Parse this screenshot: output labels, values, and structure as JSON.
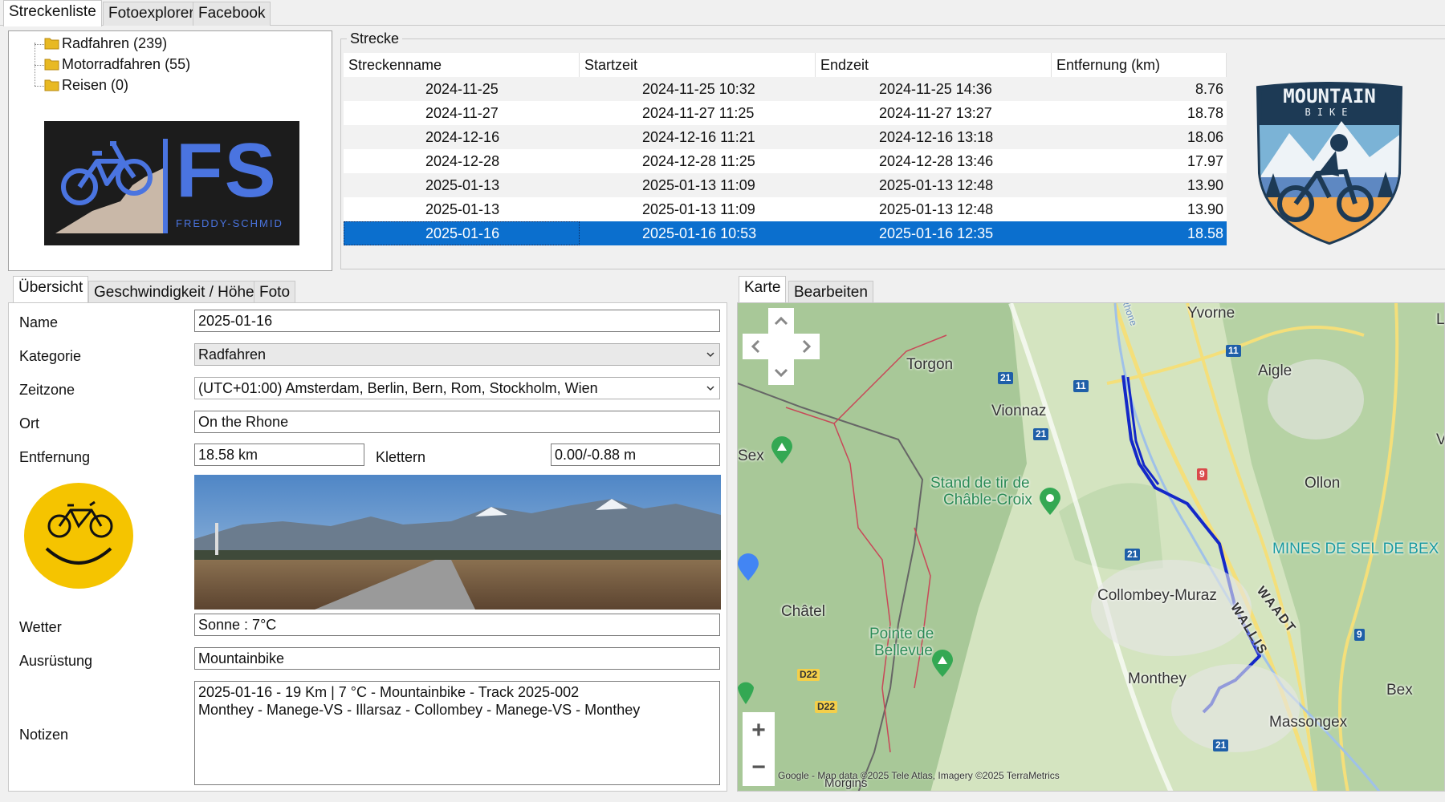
{
  "top_tabs": [
    "Streckenliste",
    "Fotoexplorer",
    "Facebook"
  ],
  "tree": [
    {
      "label": "Radfahren (239)"
    },
    {
      "label": "Motorradfahren (55)"
    },
    {
      "label": "Reisen (0)"
    }
  ],
  "logo_fs": {
    "letters": "FS",
    "subtitle": "FREDDY-SCHMID"
  },
  "strecke": {
    "group_label": "Strecke",
    "columns": [
      "Streckenname",
      "Startzeit",
      "Endzeit",
      "Entfernung (km)"
    ],
    "rows": [
      [
        "2024-11-25",
        "2024-11-25 10:32",
        "2024-11-25 14:36",
        "8.76"
      ],
      [
        "2024-11-27",
        "2024-11-27 11:25",
        "2024-11-27 13:27",
        "18.78"
      ],
      [
        "2024-12-16",
        "2024-12-16 11:21",
        "2024-12-16 13:18",
        "18.06"
      ],
      [
        "2024-12-28",
        "2024-12-28 11:25",
        "2024-12-28 13:46",
        "17.97"
      ],
      [
        "2025-01-13",
        "2025-01-13 11:09",
        "2025-01-13 12:48",
        "13.90"
      ],
      [
        "2025-01-13",
        "2025-01-13 11:09",
        "2025-01-13 12:48",
        "13.90"
      ],
      [
        "2025-01-16",
        "2025-01-16 10:53",
        "2025-01-16 12:35",
        "18.58"
      ]
    ],
    "selected_index": 6
  },
  "badge": {
    "line1": "MOUNTAIN",
    "line2": "BIKE"
  },
  "detail_tabs": [
    "Übersicht",
    "Geschwindigkeit / Höhe",
    "Foto"
  ],
  "form": {
    "name_label": "Name",
    "name_value": "2025-01-16",
    "kategorie_label": "Kategorie",
    "kategorie_value": "Radfahren",
    "zeitzone_label": "Zeitzone",
    "zeitzone_value": "(UTC+01:00) Amsterdam, Berlin, Bern, Rom, Stockholm, Wien",
    "ort_label": "Ort",
    "ort_value": "On the Rhone",
    "entfernung_label": "Entfernung",
    "entfernung_value": "18.58 km",
    "klettern_label": "Klettern",
    "klettern_value": "0.00/-0.88 m",
    "wetter_label": "Wetter",
    "wetter_value": "Sonne  :  7°C",
    "ausruestung_label": "Ausrüstung",
    "ausruestung_value": "Mountainbike",
    "notizen_label": "Notizen",
    "notizen_line1": "2025-01-16  -  19 Km  |  7 °C  -  Mountainbike  -  Track 2025-002",
    "notizen_line2": "Monthey - Manege-VS - Illarsaz - Collombey - Manege-VS - Monthey"
  },
  "map_tabs": [
    "Karte",
    "Bearbeiten"
  ],
  "map": {
    "labels": [
      "Yvorne",
      "Torgon",
      "Aigle",
      "Vionnaz",
      "Stand de tir de",
      "Châble-Croix",
      "Ollon",
      "MINES DE SEL DE BEX",
      "Collombey-Muraz",
      "WAADT",
      "WALLIS",
      "Châtel",
      "Pointe de",
      "Bellevue",
      "Monthey",
      "Bex",
      "Massongex",
      "Sex",
      "Morgins",
      "Rhone",
      "L",
      "V"
    ],
    "roads": [
      "11",
      "11",
      "21",
      "21",
      "21",
      "21",
      "9",
      "9",
      "D22",
      "D22"
    ],
    "attribution": "Google - Map data ©2025 Tele Atlas, Imagery ©2025 TerraMetrics",
    "zoom_in": "+",
    "zoom_out": "−"
  },
  "colors": {
    "selection": "#0b6fce",
    "track": "#1428c8",
    "fs_blue": "#4a74e0",
    "smiley": "#f5c400"
  }
}
